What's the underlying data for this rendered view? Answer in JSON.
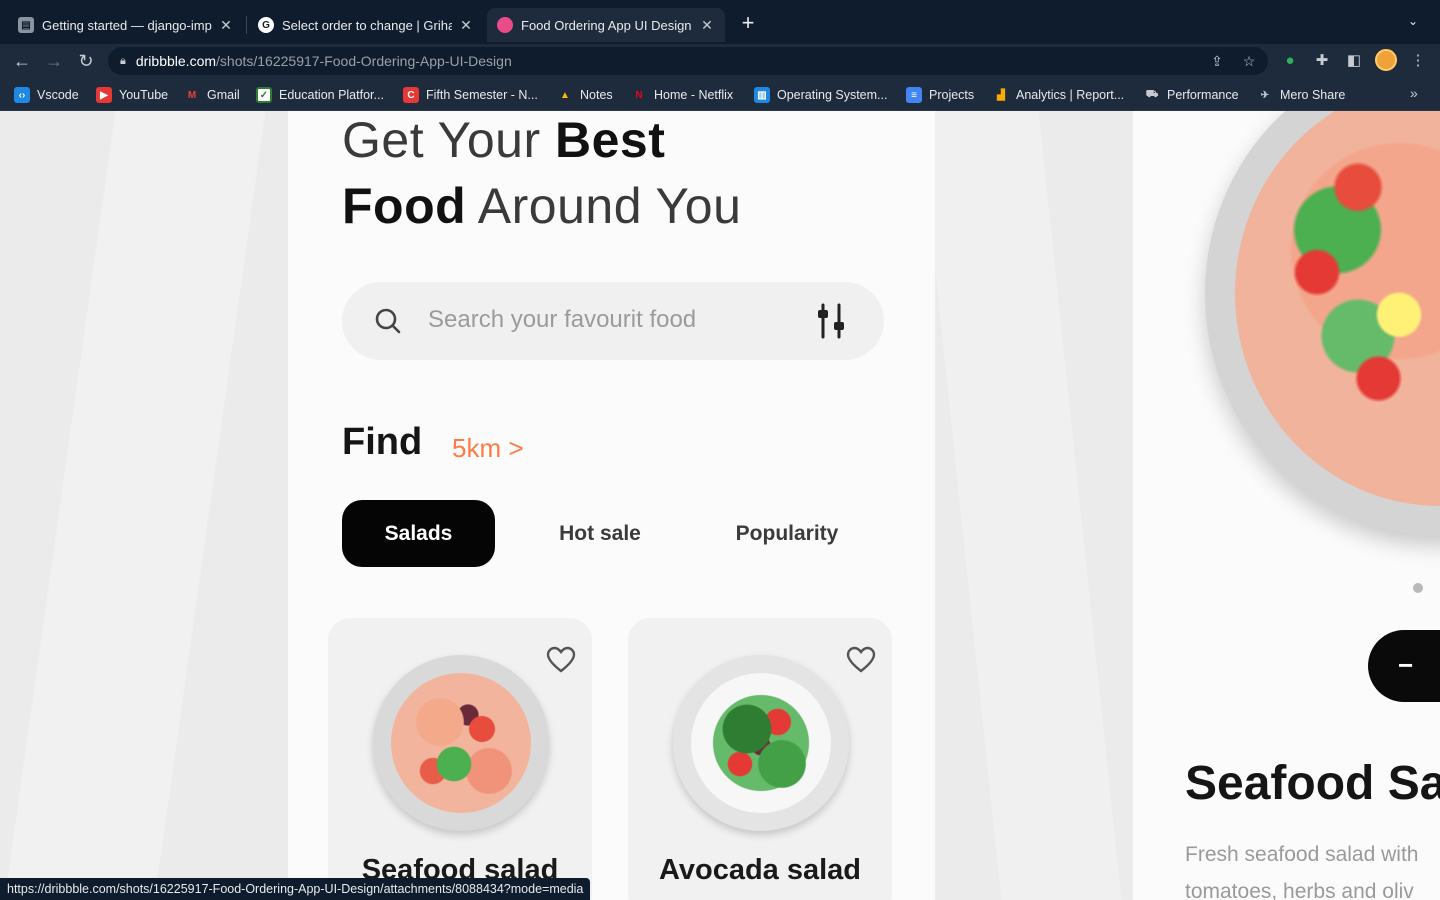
{
  "browser": {
    "tabs": [
      {
        "title": "Getting started — django-impo",
        "active": false,
        "favicon": "book-icon"
      },
      {
        "title": "Select order to change | Grihan",
        "active": false,
        "favicon": "grihan-icon"
      },
      {
        "title": "Food Ordering App UI Design b",
        "active": true,
        "favicon": "dribbble-icon"
      }
    ],
    "new_tab_label": "+",
    "url_host": "dribbble.com",
    "url_path": "/shots/16225917-Food-Ordering-App-UI-Design",
    "bookmarks": [
      {
        "label": "Vscode",
        "icon": "vscode-icon",
        "color": "#1e88e5"
      },
      {
        "label": "YouTube",
        "icon": "youtube-icon",
        "color": "#e53935"
      },
      {
        "label": "Gmail",
        "icon": "gmail-icon",
        "color": "#ea4335"
      },
      {
        "label": "Education Platfor...",
        "icon": "education-icon",
        "color": "#2e7d32"
      },
      {
        "label": "Fifth Semester - N...",
        "icon": "semester-icon",
        "color": "#e53935"
      },
      {
        "label": "Notes",
        "icon": "drive-icon",
        "color": "#fbbc04"
      },
      {
        "label": "Home - Netflix",
        "icon": "netflix-icon",
        "color": "#e50914"
      },
      {
        "label": "Operating System...",
        "icon": "os-icon",
        "color": "#1e88e5"
      },
      {
        "label": "Projects",
        "icon": "docs-icon",
        "color": "#4285f4"
      },
      {
        "label": "Analytics | Report...",
        "icon": "analytics-icon",
        "color": "#f9ab00"
      },
      {
        "label": "Performance",
        "icon": "performance-icon",
        "color": "#9aa0a6"
      },
      {
        "label": "Mero Share",
        "icon": "meroshare-icon",
        "color": "#9aa0a6"
      }
    ],
    "status_url": "https://dribbble.com/shots/16225917-Food-Ordering-App-UI-Design/attachments/8088434?mode=media"
  },
  "app": {
    "headline_line1_light": "Get Your ",
    "headline_line1_bold": "Best",
    "headline_line2_bold": "Food",
    "headline_line2_light": " Around You",
    "search_placeholder": "Search your favourit food",
    "find_label": "Find",
    "distance_label": "5km >",
    "categories": [
      "Salads",
      "Hot sale",
      "Popularity"
    ],
    "active_category": "Salads",
    "cards": [
      {
        "name": "Seafood salad",
        "favorited": false
      },
      {
        "name": "Avocada salad",
        "favorited": false
      }
    ],
    "detail_title": "Seafood Sa",
    "detail_desc_line1": "Fresh seafood  salad with",
    "detail_desc_line2": "tomatoes, herbs and oliv",
    "qty_minus": "−"
  },
  "colors": {
    "accent": "#ff7a45",
    "chip_active_bg": "#050505",
    "chrome_dark": "#0f1c2e",
    "chrome_toolbar": "#1e2b3d"
  }
}
